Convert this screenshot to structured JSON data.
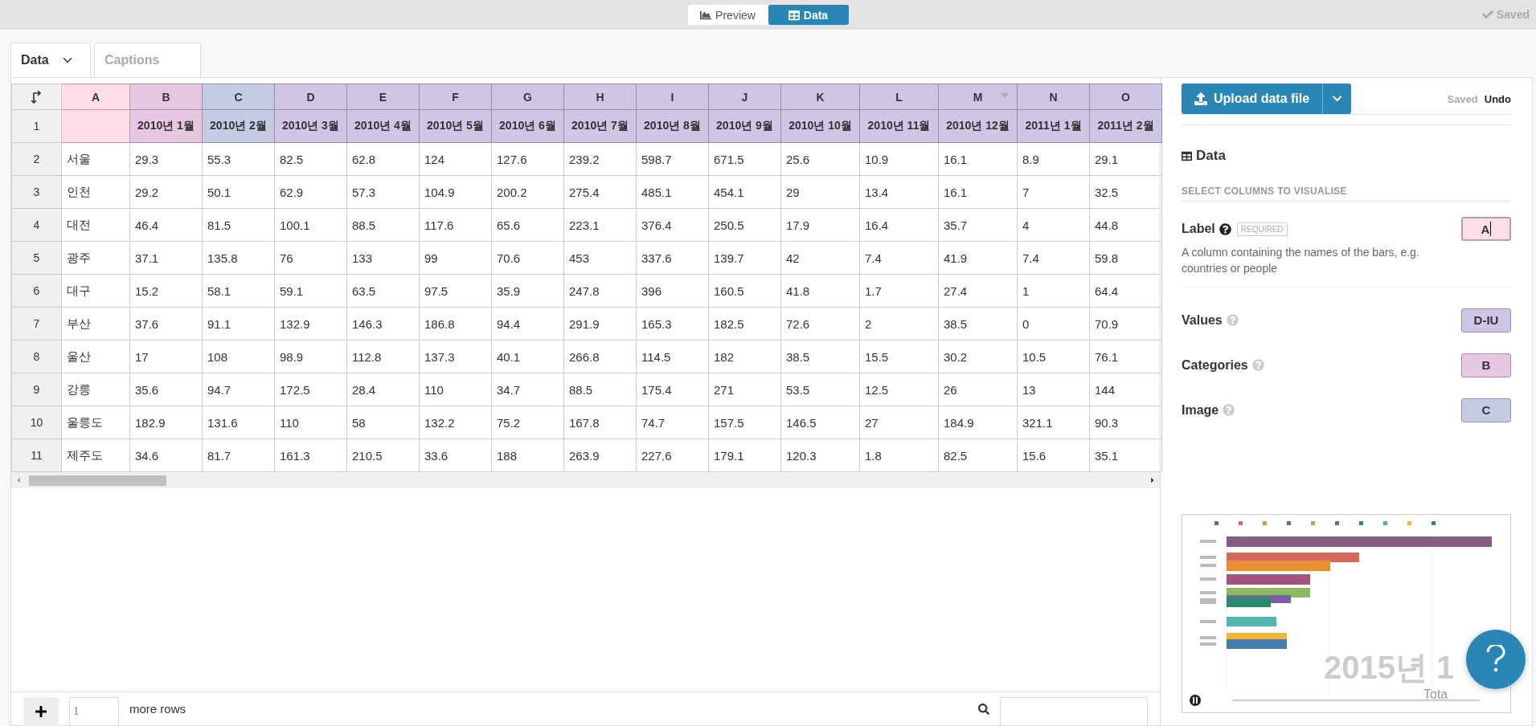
{
  "view_toggle": [
    {
      "label": "Preview",
      "kind": "chart",
      "selected": false
    },
    {
      "label": "Data",
      "kind": "table",
      "selected": true
    }
  ],
  "save_status": "Saved",
  "tabs": [
    {
      "label": "Data",
      "dropdown": true,
      "selected": true
    },
    {
      "label": "Captions",
      "dropdown": false,
      "selected": false
    }
  ],
  "table": {
    "header_row_number": "1",
    "columns": [
      {
        "letter": "A",
        "color": "#fddde6",
        "hovered": false
      },
      {
        "letter": "B",
        "title": "2010년 1월",
        "color": "#e6c6e1",
        "hovered": false
      },
      {
        "letter": "C",
        "title": "2010년 2월",
        "color": "#c5cbe3",
        "hovered": false
      },
      {
        "letter": "D",
        "title": "2010년 3월",
        "color": "#d1c5e5",
        "hovered": false
      },
      {
        "letter": "E",
        "title": "2010년 4월",
        "color": "#d1c5e5",
        "hovered": false
      },
      {
        "letter": "F",
        "title": "2010년 5월",
        "color": "#d1c5e5",
        "hovered": false
      },
      {
        "letter": "G",
        "title": "2010년 6월",
        "color": "#d1c5e5",
        "hovered": false
      },
      {
        "letter": "H",
        "title": "2010년 7월",
        "color": "#d1c5e5",
        "hovered": false
      },
      {
        "letter": "I",
        "title": "2010년 8월",
        "color": "#d1c5e5",
        "hovered": false
      },
      {
        "letter": "J",
        "title": "2010년 9월",
        "color": "#d1c5e5",
        "hovered": false
      },
      {
        "letter": "K",
        "title": "2010년 10월",
        "color": "#d1c5e5",
        "hovered": false
      },
      {
        "letter": "L",
        "title": "2010년 11월",
        "color": "#d1c5e5",
        "hovered": false
      },
      {
        "letter": "M",
        "title": "2010년 12월",
        "color": "#d1c5e5",
        "hovered": true
      },
      {
        "letter": "N",
        "title": "2011년 1월",
        "color": "#d1c5e5",
        "hovered": false
      },
      {
        "letter": "O",
        "title": "2011년 2월",
        "color": "#d1c5e5",
        "hovered": false
      }
    ],
    "rows": [
      {
        "number": "2",
        "cells": [
          "서울",
          "29.3",
          "55.3",
          "82.5",
          "62.8",
          "124",
          "127.6",
          "239.2",
          "598.7",
          "671.5",
          "25.6",
          "10.9",
          "16.1",
          "8.9",
          "29.1"
        ]
      },
      {
        "number": "3",
        "cells": [
          "인천",
          "29.2",
          "50.1",
          "62.9",
          "57.3",
          "104.9",
          "200.2",
          "275.4",
          "485.1",
          "454.1",
          "29",
          "13.4",
          "16.1",
          "7",
          "32.5"
        ]
      },
      {
        "number": "4",
        "cells": [
          "대전",
          "46.4",
          "81.5",
          "100.1",
          "88.5",
          "117.6",
          "65.6",
          "223.1",
          "376.4",
          "250.5",
          "17.9",
          "16.4",
          "35.7",
          "4",
          "44.8"
        ]
      },
      {
        "number": "5",
        "cells": [
          "광주",
          "37.1",
          "135.8",
          "76",
          "133",
          "99",
          "70.6",
          "453",
          "337.6",
          "139.7",
          "42",
          "7.4",
          "41.9",
          "7.4",
          "59.8"
        ]
      },
      {
        "number": "6",
        "cells": [
          "대구",
          "15.2",
          "58.1",
          "59.1",
          "63.5",
          "97.5",
          "35.9",
          "247.8",
          "396",
          "160.5",
          "41.8",
          "1.7",
          "27.4",
          "1",
          "64.4"
        ]
      },
      {
        "number": "7",
        "cells": [
          "부산",
          "37.6",
          "91.1",
          "132.9",
          "146.3",
          "186.8",
          "94.4",
          "291.9",
          "165.3",
          "182.5",
          "72.6",
          "2",
          "38.5",
          "0",
          "70.9"
        ]
      },
      {
        "number": "8",
        "cells": [
          "울산",
          "17",
          "108",
          "98.9",
          "112.8",
          "137.3",
          "40.1",
          "266.8",
          "114.5",
          "182",
          "38.5",
          "15.5",
          "30.2",
          "10.5",
          "76.1"
        ]
      },
      {
        "number": "9",
        "cells": [
          "강릉",
          "35.6",
          "94.7",
          "172.5",
          "28.4",
          "110",
          "34.7",
          "88.5",
          "175.4",
          "271",
          "53.5",
          "12.5",
          "26",
          "13",
          "144"
        ]
      },
      {
        "number": "10",
        "cells": [
          "울릉도",
          "182.9",
          "131.6",
          "110",
          "58",
          "132.2",
          "75.2",
          "167.8",
          "74.7",
          "157.5",
          "146.5",
          "27",
          "184.9",
          "321.1",
          "90.3"
        ]
      },
      {
        "number": "11",
        "cells": [
          "제주도",
          "34.6",
          "81.7",
          "161.3",
          "210.5",
          "33.6",
          "188",
          "263.9",
          "227.6",
          "179.1",
          "120.3",
          "1.8",
          "82.5",
          "15.6",
          "35.1"
        ]
      }
    ]
  },
  "footer": {
    "rows_value": "1",
    "rows_label": "more rows"
  },
  "panel": {
    "upload_label": "Upload data file",
    "status": "Saved",
    "undo": "Undo",
    "heading": "Data",
    "section": "SELECT COLUMNS TO VISUALISE",
    "fields": [
      {
        "label": "Label",
        "help_active": true,
        "badge": "REQUIRED",
        "description": "A column containing the names of the bars, e.g. countries or people",
        "value": "A",
        "color": "#fddde6",
        "focused": true
      },
      {
        "label": "Values",
        "help_active": false,
        "value": "D-IU",
        "color": "#d1c5e5",
        "focused": false
      },
      {
        "label": "Categories",
        "help_active": false,
        "value": "B",
        "color": "#e6c6e1",
        "focused": false
      },
      {
        "label": "Image",
        "help_active": false,
        "value": "C",
        "color": "#c5cbe3",
        "focused": false
      }
    ],
    "preview": {
      "year_label": "2015년 1",
      "total_label": "Tota"
    }
  }
}
